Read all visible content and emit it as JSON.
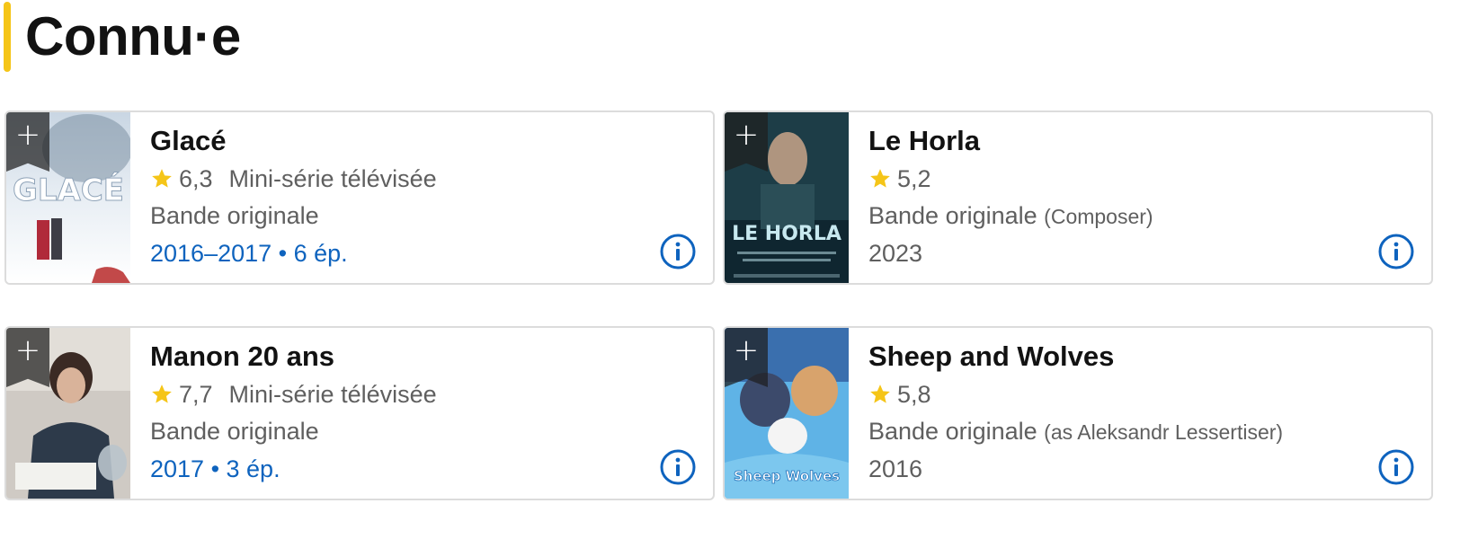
{
  "section": {
    "title": "Connu·e"
  },
  "colors": {
    "accent": "#f5c518",
    "link": "#0e63be",
    "star": "#f5c518"
  },
  "cards": [
    {
      "title": "Glacé",
      "rating": "6,3",
      "type": "Mini-série télévisée",
      "role": "Bande originale",
      "role_note": "",
      "years": "2016–2017 • 6 ép.",
      "poster_text": "GLACÉ",
      "watchlist_label": "+"
    },
    {
      "title": "Le Horla",
      "rating": "5,2",
      "type": "",
      "role": "Bande originale",
      "role_note": "(Composer)",
      "years": "2023",
      "poster_text": "LE HORLA",
      "watchlist_label": "+"
    },
    {
      "title": "Manon 20 ans",
      "rating": "7,7",
      "type": "Mini-série télévisée",
      "role": "Bande originale",
      "role_note": "",
      "years": "2017 • 3 ép.",
      "poster_text": "",
      "watchlist_label": "+"
    },
    {
      "title": "Sheep and Wolves",
      "rating": "5,8",
      "type": "",
      "role": "Bande originale",
      "role_note": "(as Aleksandr Lessertiser)",
      "years": "2016",
      "poster_text": "Sheep Wolves",
      "watchlist_label": "+"
    }
  ]
}
